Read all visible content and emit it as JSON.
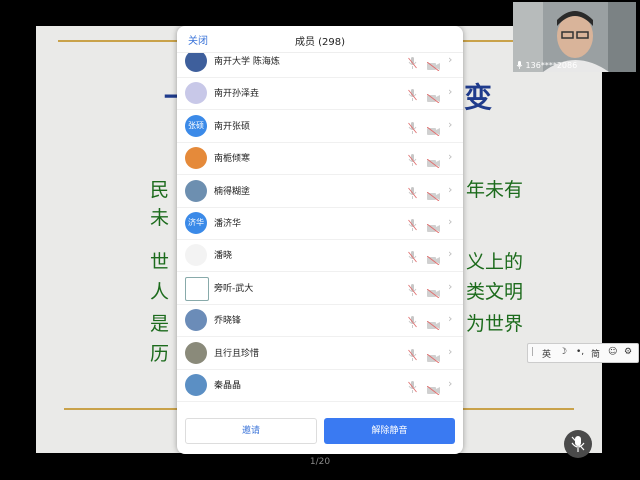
{
  "slide": {
    "title_left": "一",
    "title_right": "变",
    "line1_left": "民",
    "line1_right": "年未有",
    "line2_left": "未",
    "line3_left": "世",
    "line3_right": "义上的",
    "line4_left": "人",
    "line4_right": "类文明",
    "line5_left": "是",
    "line5_right": "为世界",
    "line6_left": "历"
  },
  "page_indicator": "1/20",
  "panel": {
    "close_label": "关闭",
    "title": "成员 (298)",
    "invite_label": "邀请",
    "unmute_label": "解除静音",
    "members": [
      {
        "name": "南开大学 陈海炼",
        "avatar_text": "",
        "avatar_color": "#3e5f9c"
      },
      {
        "name": "南开孙泽垚",
        "avatar_text": "",
        "avatar_color": "#c8c8e8"
      },
      {
        "name": "南开张硕",
        "avatar_text": "张硕",
        "avatar_color": "#3b8ae8"
      },
      {
        "name": "南栀倾寒",
        "avatar_text": "",
        "avatar_color": "#e58a3a"
      },
      {
        "name": "楠得糊塗",
        "avatar_text": "",
        "avatar_color": "#6d8fb0"
      },
      {
        "name": "潘济华",
        "avatar_text": "济华",
        "avatar_color": "#3b8ae8"
      },
      {
        "name": "潘晓",
        "avatar_text": "",
        "avatar_color": "#f3f3f3"
      },
      {
        "name": "旁听-武大",
        "avatar_text": "",
        "avatar_color": "#ffffff"
      },
      {
        "name": "乔晓锋",
        "avatar_text": "",
        "avatar_color": "#6b8cb8"
      },
      {
        "name": "且行且珍惜",
        "avatar_text": "",
        "avatar_color": "#8a8a7a"
      },
      {
        "name": "秦晶晶",
        "avatar_text": "",
        "avatar_color": "#5b8fc4"
      }
    ]
  },
  "video": {
    "label": "136****2086"
  },
  "ime": {
    "english": "英",
    "simplified": "简"
  },
  "icons": {
    "mic": "mic-muted-icon",
    "camera": "camera-off-icon",
    "chevron": "chevron-right-icon"
  }
}
